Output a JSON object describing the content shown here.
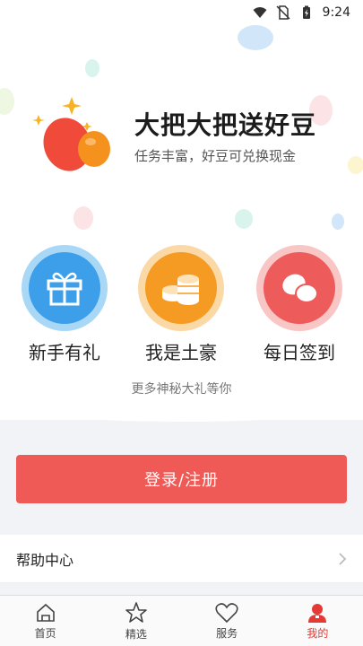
{
  "status_bar": {
    "time": "9:24"
  },
  "hero": {
    "title": "大把大把送好豆",
    "subtitle": "任务丰富，好豆可兑换现金"
  },
  "features": [
    {
      "label": "新手有礼",
      "icon": "gift-icon",
      "outer": "#a9d8f7",
      "inner": "#3d9fea"
    },
    {
      "label": "我是土豪",
      "icon": "coins-icon",
      "outer": "#fbd9a6",
      "inner": "#f59a22"
    },
    {
      "label": "每日签到",
      "icon": "beans-icon",
      "outer": "#f9c6c6",
      "inner": "#ee5b5b"
    }
  ],
  "hint": "更多神秘大礼等你",
  "login_button": "登录/注册",
  "help_center": "帮助中心",
  "tabs": [
    {
      "label": "首页",
      "icon": "home-icon"
    },
    {
      "label": "精选",
      "icon": "star-icon"
    },
    {
      "label": "服务",
      "icon": "heart-icon"
    },
    {
      "label": "我的",
      "icon": "person-icon",
      "active": true
    }
  ],
  "colors": {
    "accent": "#ef5a56",
    "active_tab": "#e53935"
  }
}
